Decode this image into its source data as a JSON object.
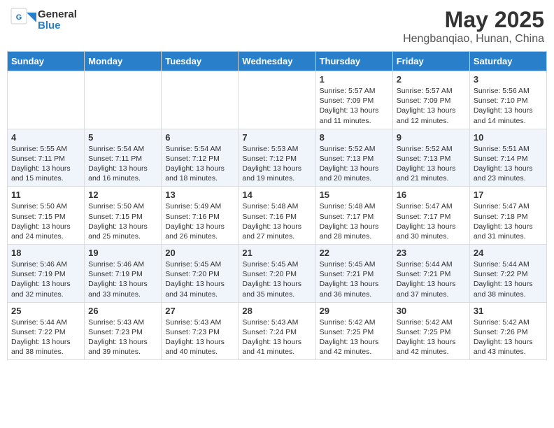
{
  "header": {
    "logo_line1": "General",
    "logo_line2": "Blue",
    "main_title": "May 2025",
    "subtitle": "Hengbanqiao, Hunan, China"
  },
  "days_of_week": [
    "Sunday",
    "Monday",
    "Tuesday",
    "Wednesday",
    "Thursday",
    "Friday",
    "Saturday"
  ],
  "weeks": [
    [
      {
        "day": "",
        "info": ""
      },
      {
        "day": "",
        "info": ""
      },
      {
        "day": "",
        "info": ""
      },
      {
        "day": "",
        "info": ""
      },
      {
        "day": "1",
        "info": "Sunrise: 5:57 AM\nSunset: 7:09 PM\nDaylight: 13 hours and 11 minutes."
      },
      {
        "day": "2",
        "info": "Sunrise: 5:57 AM\nSunset: 7:09 PM\nDaylight: 13 hours and 12 minutes."
      },
      {
        "day": "3",
        "info": "Sunrise: 5:56 AM\nSunset: 7:10 PM\nDaylight: 13 hours and 14 minutes."
      }
    ],
    [
      {
        "day": "4",
        "info": "Sunrise: 5:55 AM\nSunset: 7:11 PM\nDaylight: 13 hours and 15 minutes."
      },
      {
        "day": "5",
        "info": "Sunrise: 5:54 AM\nSunset: 7:11 PM\nDaylight: 13 hours and 16 minutes."
      },
      {
        "day": "6",
        "info": "Sunrise: 5:54 AM\nSunset: 7:12 PM\nDaylight: 13 hours and 18 minutes."
      },
      {
        "day": "7",
        "info": "Sunrise: 5:53 AM\nSunset: 7:12 PM\nDaylight: 13 hours and 19 minutes."
      },
      {
        "day": "8",
        "info": "Sunrise: 5:52 AM\nSunset: 7:13 PM\nDaylight: 13 hours and 20 minutes."
      },
      {
        "day": "9",
        "info": "Sunrise: 5:52 AM\nSunset: 7:13 PM\nDaylight: 13 hours and 21 minutes."
      },
      {
        "day": "10",
        "info": "Sunrise: 5:51 AM\nSunset: 7:14 PM\nDaylight: 13 hours and 23 minutes."
      }
    ],
    [
      {
        "day": "11",
        "info": "Sunrise: 5:50 AM\nSunset: 7:15 PM\nDaylight: 13 hours and 24 minutes."
      },
      {
        "day": "12",
        "info": "Sunrise: 5:50 AM\nSunset: 7:15 PM\nDaylight: 13 hours and 25 minutes."
      },
      {
        "day": "13",
        "info": "Sunrise: 5:49 AM\nSunset: 7:16 PM\nDaylight: 13 hours and 26 minutes."
      },
      {
        "day": "14",
        "info": "Sunrise: 5:48 AM\nSunset: 7:16 PM\nDaylight: 13 hours and 27 minutes."
      },
      {
        "day": "15",
        "info": "Sunrise: 5:48 AM\nSunset: 7:17 PM\nDaylight: 13 hours and 28 minutes."
      },
      {
        "day": "16",
        "info": "Sunrise: 5:47 AM\nSunset: 7:17 PM\nDaylight: 13 hours and 30 minutes."
      },
      {
        "day": "17",
        "info": "Sunrise: 5:47 AM\nSunset: 7:18 PM\nDaylight: 13 hours and 31 minutes."
      }
    ],
    [
      {
        "day": "18",
        "info": "Sunrise: 5:46 AM\nSunset: 7:19 PM\nDaylight: 13 hours and 32 minutes."
      },
      {
        "day": "19",
        "info": "Sunrise: 5:46 AM\nSunset: 7:19 PM\nDaylight: 13 hours and 33 minutes."
      },
      {
        "day": "20",
        "info": "Sunrise: 5:45 AM\nSunset: 7:20 PM\nDaylight: 13 hours and 34 minutes."
      },
      {
        "day": "21",
        "info": "Sunrise: 5:45 AM\nSunset: 7:20 PM\nDaylight: 13 hours and 35 minutes."
      },
      {
        "day": "22",
        "info": "Sunrise: 5:45 AM\nSunset: 7:21 PM\nDaylight: 13 hours and 36 minutes."
      },
      {
        "day": "23",
        "info": "Sunrise: 5:44 AM\nSunset: 7:21 PM\nDaylight: 13 hours and 37 minutes."
      },
      {
        "day": "24",
        "info": "Sunrise: 5:44 AM\nSunset: 7:22 PM\nDaylight: 13 hours and 38 minutes."
      }
    ],
    [
      {
        "day": "25",
        "info": "Sunrise: 5:44 AM\nSunset: 7:22 PM\nDaylight: 13 hours and 38 minutes."
      },
      {
        "day": "26",
        "info": "Sunrise: 5:43 AM\nSunset: 7:23 PM\nDaylight: 13 hours and 39 minutes."
      },
      {
        "day": "27",
        "info": "Sunrise: 5:43 AM\nSunset: 7:23 PM\nDaylight: 13 hours and 40 minutes."
      },
      {
        "day": "28",
        "info": "Sunrise: 5:43 AM\nSunset: 7:24 PM\nDaylight: 13 hours and 41 minutes."
      },
      {
        "day": "29",
        "info": "Sunrise: 5:42 AM\nSunset: 7:25 PM\nDaylight: 13 hours and 42 minutes."
      },
      {
        "day": "30",
        "info": "Sunrise: 5:42 AM\nSunset: 7:25 PM\nDaylight: 13 hours and 42 minutes."
      },
      {
        "day": "31",
        "info": "Sunrise: 5:42 AM\nSunset: 7:26 PM\nDaylight: 13 hours and 43 minutes."
      }
    ]
  ]
}
